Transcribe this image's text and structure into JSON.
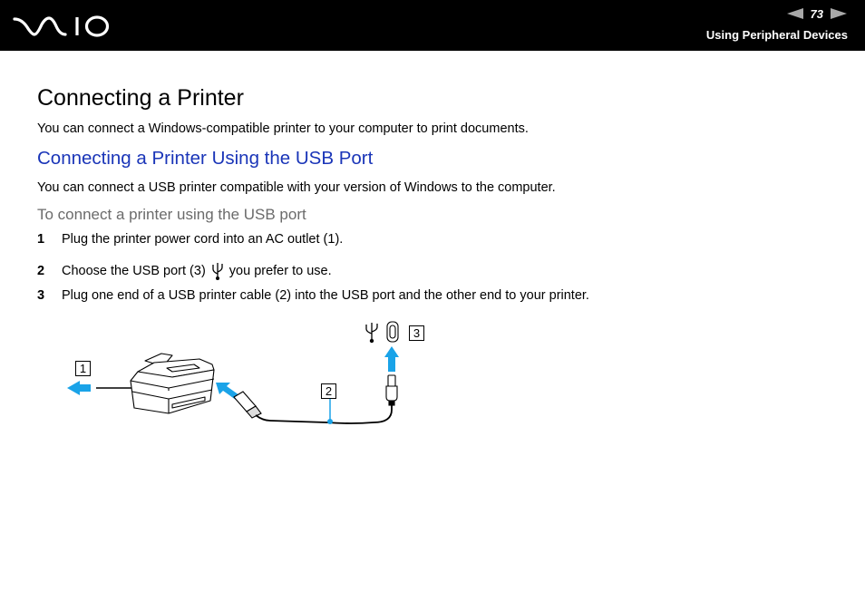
{
  "header": {
    "logo_text": "VAIO",
    "page_number": "73",
    "section_title": "Using Peripheral Devices",
    "prev_icon": "arrow-left-icon",
    "next_icon": "arrow-right-icon"
  },
  "content": {
    "title": "Connecting a Printer",
    "intro": "You can connect a Windows-compatible printer to your computer to print documents.",
    "subheading": "Connecting a Printer Using the USB Port",
    "sub_intro": "You can connect a USB printer compatible with your version of Windows to the computer.",
    "procedure_title": "To connect a printer using the USB port",
    "steps": [
      {
        "number": "1",
        "text": "Plug the printer power cord into an AC outlet (1)."
      },
      {
        "number": "2",
        "text_before": "Choose the USB port (3)",
        "icon": "usb-icon",
        "text_after": "you prefer to use."
      },
      {
        "number": "3",
        "text": "Plug one end of a USB printer cable (2) into the USB port and the other end to your printer."
      }
    ]
  },
  "figure": {
    "callouts": [
      "1",
      "2",
      "3"
    ],
    "accent_color": "#1aa3e8",
    "icons": [
      "printer-icon",
      "usb-icon",
      "usb-port-icon",
      "usb-plug-icon"
    ]
  },
  "colors": {
    "header_bg": "#000000",
    "subheading": "#1a35b8",
    "procedure_title": "#6b6b6b",
    "arrow": "#1aa3e8"
  }
}
